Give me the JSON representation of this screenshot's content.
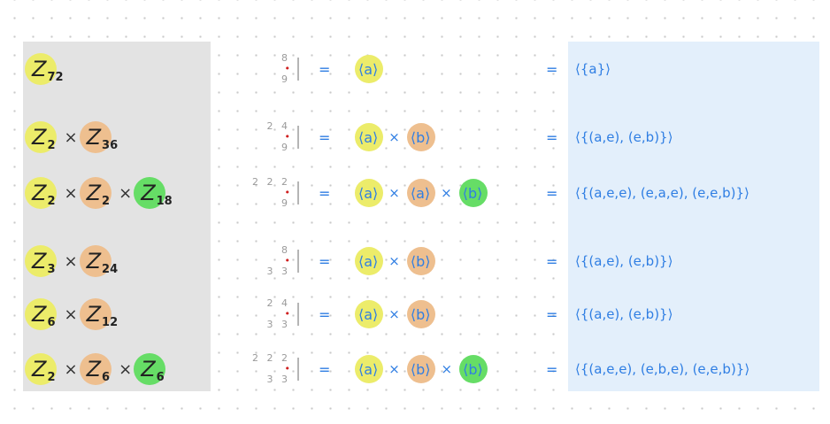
{
  "colors": {
    "left_panel": "#e3e3e3",
    "right_panel": "#e3effb",
    "ink_blue": "#2f7ee3",
    "highlight_yellow": "#ecec6a",
    "highlight_orange": "#eebf8f",
    "highlight_green": "#66dd66",
    "note_dot_red": "#d02020"
  },
  "eq_symbol": "=",
  "times_symbol": "×",
  "rows": [
    {
      "groups": [
        {
          "sym": "Z",
          "sub": "72",
          "color": "yellow"
        }
      ],
      "note": {
        "top": "8",
        "bottom": "9"
      },
      "gens": [
        {
          "text": "⟨a⟩",
          "color": "yellow"
        }
      ],
      "set": "⟨{a}⟩"
    },
    {
      "groups": [
        {
          "sym": "Z",
          "sub": "2",
          "color": "yellow"
        },
        {
          "sym": "Z",
          "sub": "36",
          "color": "orange"
        }
      ],
      "note": {
        "top": "2 4",
        "bottom": "9"
      },
      "gens": [
        {
          "text": "⟨a⟩",
          "color": "yellow"
        },
        {
          "text": "⟨b⟩",
          "color": "orange"
        }
      ],
      "set": "⟨{(a,e), (e,b)}⟩"
    },
    {
      "groups": [
        {
          "sym": "Z",
          "sub": "2",
          "color": "yellow"
        },
        {
          "sym": "Z",
          "sub": "2",
          "color": "orange"
        },
        {
          "sym": "Z",
          "sub": "18",
          "color": "green"
        }
      ],
      "note": {
        "top": "2 2 2",
        "bottom": "9"
      },
      "gens": [
        {
          "text": "⟨a⟩",
          "color": "yellow"
        },
        {
          "text": "⟨a⟩",
          "color": "orange"
        },
        {
          "text": "⟨b⟩",
          "color": "green"
        }
      ],
      "set": "⟨{(a,e,e), (e,a,e), (e,e,b)}⟩"
    },
    {
      "groups": [
        {
          "sym": "Z",
          "sub": "3",
          "color": "yellow"
        },
        {
          "sym": "Z",
          "sub": "24",
          "color": "orange"
        }
      ],
      "note": {
        "top": "8",
        "bottom": "3 3"
      },
      "gens": [
        {
          "text": "⟨a⟩",
          "color": "yellow"
        },
        {
          "text": "⟨b⟩",
          "color": "orange"
        }
      ],
      "set": "⟨{(a,e), (e,b)}⟩"
    },
    {
      "groups": [
        {
          "sym": "Z",
          "sub": "6",
          "color": "yellow"
        },
        {
          "sym": "Z",
          "sub": "12",
          "color": "orange"
        }
      ],
      "note": {
        "top": "2 4",
        "bottom": "3 3"
      },
      "gens": [
        {
          "text": "⟨a⟩",
          "color": "yellow"
        },
        {
          "text": "⟨b⟩",
          "color": "orange"
        }
      ],
      "set": "⟨{(a,e), (e,b)}⟩"
    },
    {
      "groups": [
        {
          "sym": "Z",
          "sub": "2",
          "color": "yellow"
        },
        {
          "sym": "Z",
          "sub": "6",
          "color": "orange"
        },
        {
          "sym": "Z",
          "sub": "6",
          "color": "green"
        }
      ],
      "note": {
        "top": "2 2 2",
        "bottom": "3 3"
      },
      "gens": [
        {
          "text": "⟨a⟩",
          "color": "yellow"
        },
        {
          "text": "⟨b⟩",
          "color": "orange"
        },
        {
          "text": "⟨b⟩",
          "color": "green"
        }
      ],
      "set": "⟨{(a,e,e), (e,b,e), (e,e,b)}⟩"
    }
  ]
}
